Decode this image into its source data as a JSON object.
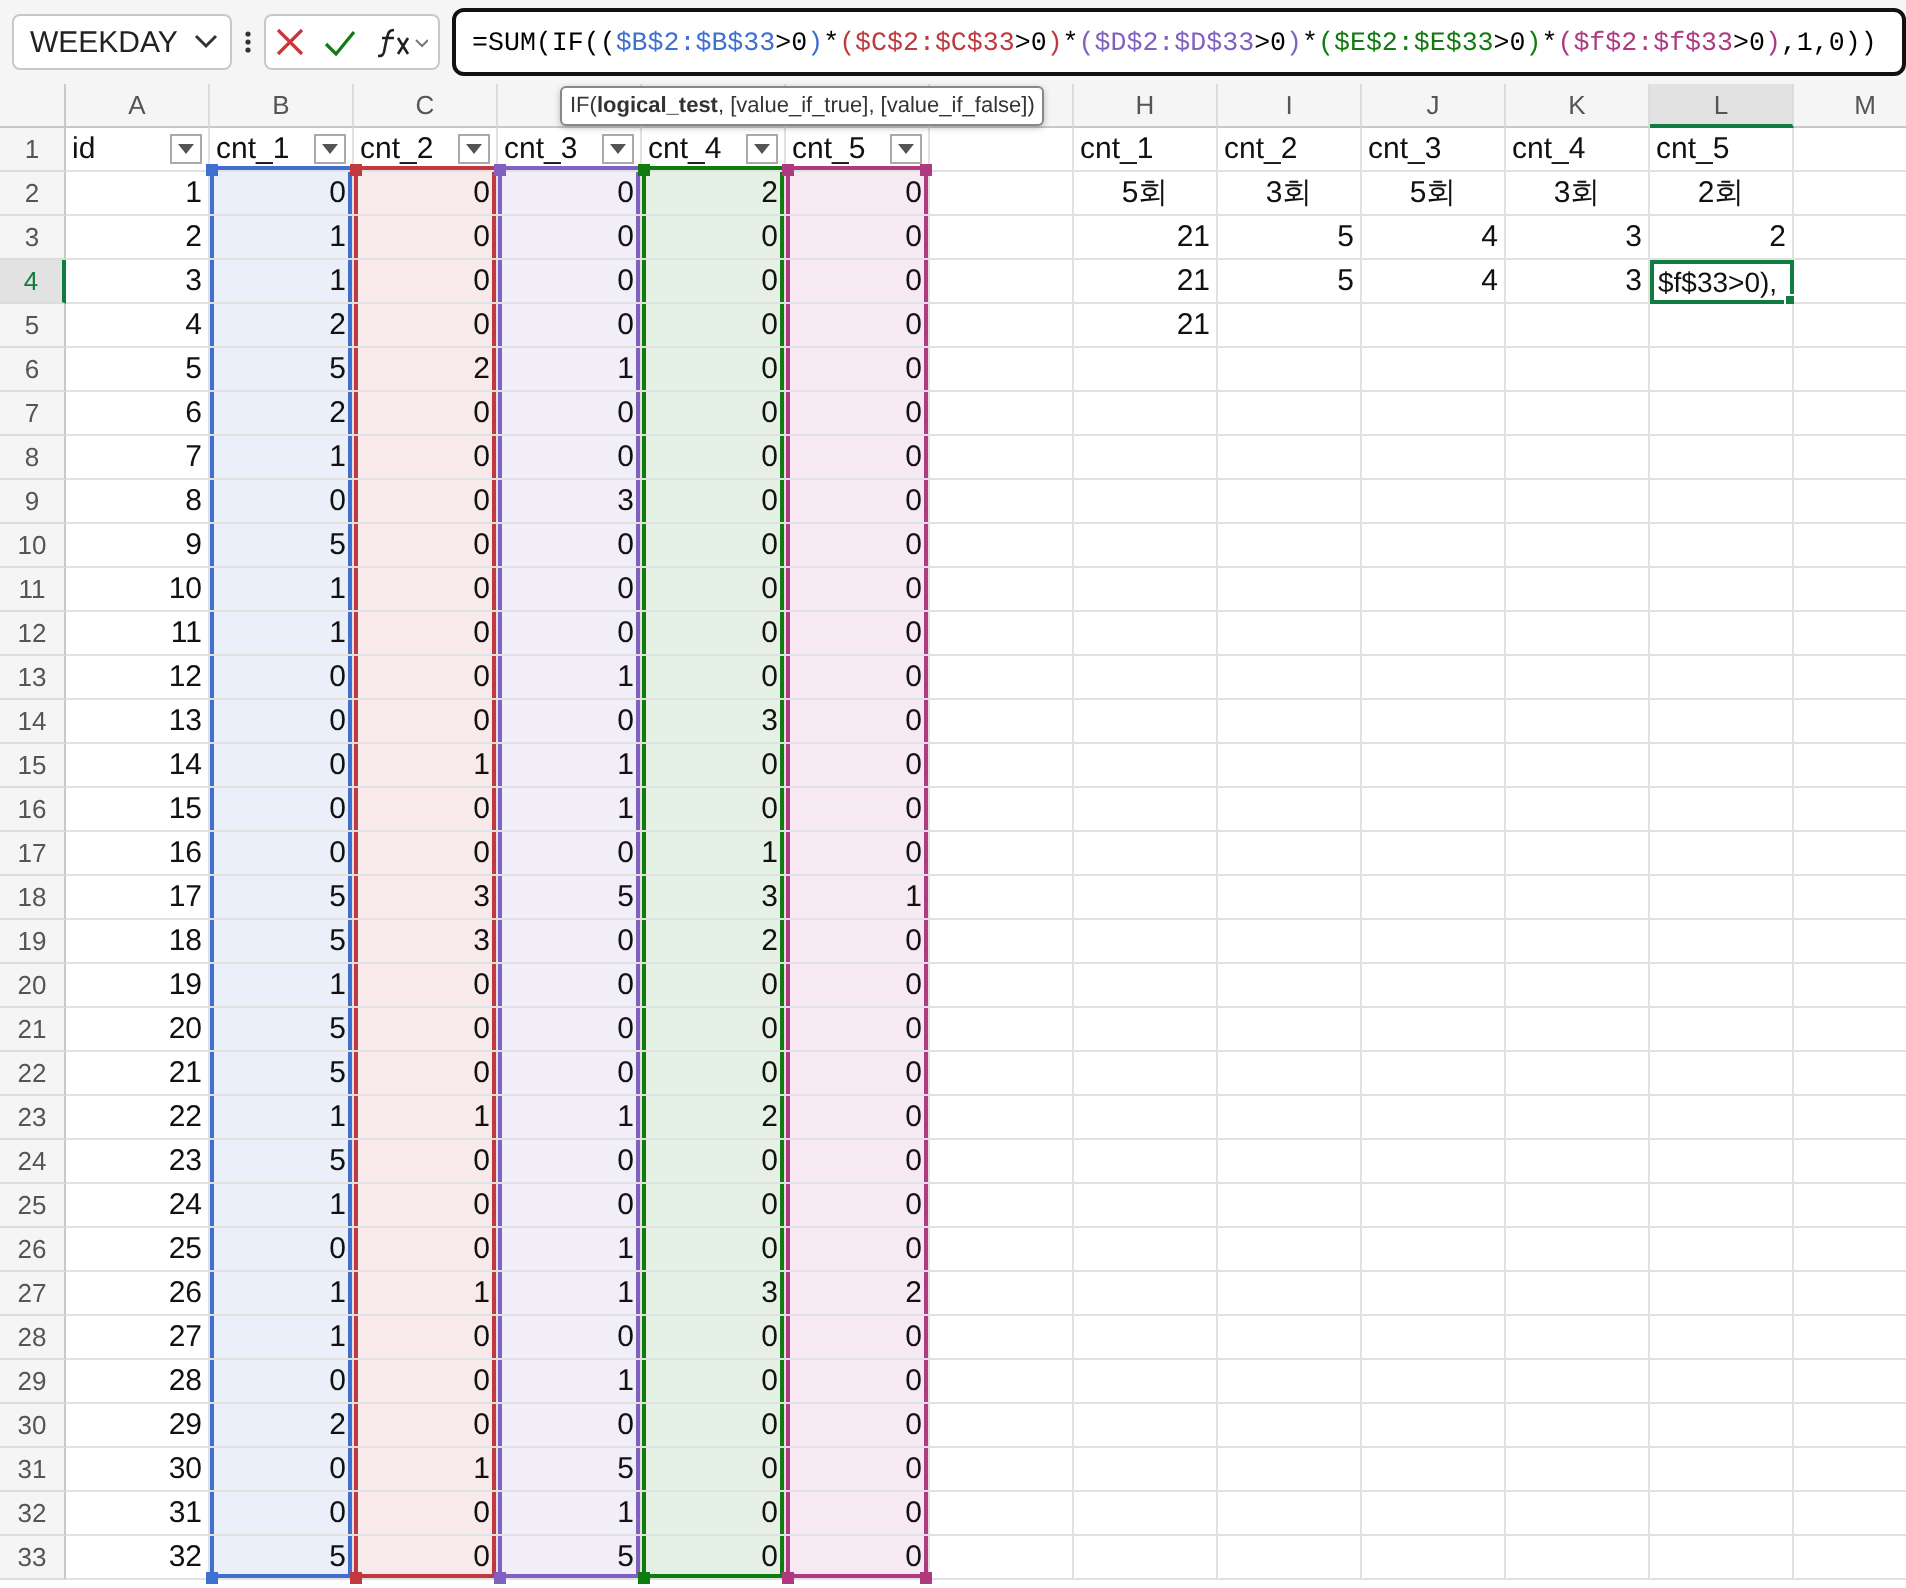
{
  "name_box": {
    "value": "WEEKDAY"
  },
  "formula_bar": {
    "segments": [
      {
        "text": "=SUM(IF(",
        "color": "#000000"
      },
      {
        "text": "(",
        "color": "#000000"
      },
      {
        "text": "$B$2:$B$33",
        "color": "#3f6fd0"
      },
      {
        "text": ">0",
        "color": "#000000"
      },
      {
        "text": ")",
        "color": "#3f6fd0"
      },
      {
        "text": "*",
        "color": "#000000"
      },
      {
        "text": "(",
        "color": "#c0393e"
      },
      {
        "text": "$C$2:$C$33",
        "color": "#c0393e"
      },
      {
        "text": ">0",
        "color": "#000000"
      },
      {
        "text": ")",
        "color": "#c0393e"
      },
      {
        "text": "*",
        "color": "#000000"
      },
      {
        "text": "(",
        "color": "#8060c0"
      },
      {
        "text": "$D$2:$D$33",
        "color": "#8060c0"
      },
      {
        "text": ">0",
        "color": "#000000"
      },
      {
        "text": ")",
        "color": "#8060c0"
      },
      {
        "text": "*",
        "color": "#000000"
      },
      {
        "text": "(",
        "color": "#107c10"
      },
      {
        "text": "$E$2:$E$33",
        "color": "#107c10"
      },
      {
        "text": ">0",
        "color": "#000000"
      },
      {
        "text": ")",
        "color": "#107c10"
      },
      {
        "text": "*",
        "color": "#000000"
      },
      {
        "text": "(",
        "color": "#b03a80"
      },
      {
        "text": "$f$2:$f$33",
        "color": "#b03a80"
      },
      {
        "text": ">0",
        "color": "#000000"
      },
      {
        "text": ")",
        "color": "#b03a80"
      },
      {
        "text": ",1,0))",
        "color": "#000000"
      }
    ]
  },
  "tooltip": "IF(**logical_test**, [value_if_true], [value_if_false])",
  "column_headers": [
    {
      "label": "A",
      "selected": false
    },
    {
      "label": "B",
      "selected": false
    },
    {
      "label": "C",
      "selected": false
    },
    {
      "selected": false
    },
    {
      "selected": false
    },
    {
      "selected": false
    },
    {
      "selected": false
    },
    {
      "label": "H",
      "selected": false
    },
    {
      "label": "I",
      "selected": false
    },
    {
      "label": "J",
      "selected": false
    },
    {
      "label": "K",
      "selected": false
    },
    {
      "label": "L",
      "selected": true
    },
    {
      "label": "M",
      "selected": false
    }
  ],
  "row_headers": [
    {
      "label": "1",
      "selected": false
    },
    {
      "label": "2",
      "selected": false
    },
    {
      "label": "3",
      "selected": false
    },
    {
      "label": "4",
      "selected": true
    },
    {
      "label": "5",
      "selected": false
    },
    {
      "label": "6",
      "selected": false
    },
    {
      "label": "7",
      "selected": false
    },
    {
      "label": "8",
      "selected": false
    },
    {
      "label": "9",
      "selected": false
    },
    {
      "label": "10",
      "selected": false
    },
    {
      "label": "11",
      "selected": false
    },
    {
      "label": "12",
      "selected": false
    },
    {
      "label": "13",
      "selected": false
    },
    {
      "label": "14",
      "selected": false
    },
    {
      "label": "15",
      "selected": false
    },
    {
      "label": "16",
      "selected": false
    },
    {
      "label": "17",
      "selected": false
    },
    {
      "label": "18",
      "selected": false
    },
    {
      "label": "19",
      "selected": false
    },
    {
      "label": "20",
      "selected": false
    },
    {
      "label": "21",
      "selected": false
    },
    {
      "label": "22",
      "selected": false
    },
    {
      "label": "23",
      "selected": false
    },
    {
      "label": "24",
      "selected": false
    },
    {
      "label": "25",
      "selected": false
    },
    {
      "label": "26",
      "selected": false
    },
    {
      "label": "27",
      "selected": false
    },
    {
      "label": "28",
      "selected": false
    },
    {
      "label": "29",
      "selected": false
    },
    {
      "label": "30",
      "selected": false
    },
    {
      "label": "31",
      "selected": false
    },
    {
      "label": "32",
      "selected": false
    },
    {
      "label": "33",
      "selected": false
    }
  ],
  "table": {
    "columns": [
      {
        "label": "id"
      },
      {
        "label": "cnt_1",
        "color": "#3f6fd0"
      },
      {
        "label": "cnt_2",
        "color": "#c0393e"
      },
      {
        "label": "cnt_3",
        "color": "#8060c0"
      },
      {
        "label": "cnt_4",
        "color": "#107c10"
      },
      {
        "label": "cnt_5",
        "color": "#b03a80"
      }
    ],
    "rows": [
      [
        "1",
        "0",
        "0",
        "0",
        "2",
        "0"
      ],
      [
        "2",
        "1",
        "0",
        "0",
        "0",
        "0"
      ],
      [
        "3",
        "1",
        "0",
        "0",
        "0",
        "0"
      ],
      [
        "4",
        "2",
        "0",
        "0",
        "0",
        "0"
      ],
      [
        "5",
        "5",
        "2",
        "1",
        "0",
        "0"
      ],
      [
        "6",
        "2",
        "0",
        "0",
        "0",
        "0"
      ],
      [
        "7",
        "1",
        "0",
        "0",
        "0",
        "0"
      ],
      [
        "8",
        "0",
        "0",
        "3",
        "0",
        "0"
      ],
      [
        "9",
        "5",
        "0",
        "0",
        "0",
        "0"
      ],
      [
        "10",
        "1",
        "0",
        "0",
        "0",
        "0"
      ],
      [
        "11",
        "1",
        "0",
        "0",
        "0",
        "0"
      ],
      [
        "12",
        "0",
        "0",
        "1",
        "0",
        "0"
      ],
      [
        "13",
        "0",
        "0",
        "0",
        "3",
        "0"
      ],
      [
        "14",
        "0",
        "1",
        "1",
        "0",
        "0"
      ],
      [
        "15",
        "0",
        "0",
        "1",
        "0",
        "0"
      ],
      [
        "16",
        "0",
        "0",
        "0",
        "1",
        "0"
      ],
      [
        "17",
        "5",
        "3",
        "5",
        "3",
        "1"
      ],
      [
        "18",
        "5",
        "3",
        "0",
        "2",
        "0"
      ],
      [
        "19",
        "1",
        "0",
        "0",
        "0",
        "0"
      ],
      [
        "20",
        "5",
        "0",
        "0",
        "0",
        "0"
      ],
      [
        "21",
        "5",
        "0",
        "0",
        "0",
        "0"
      ],
      [
        "22",
        "1",
        "1",
        "1",
        "2",
        "0"
      ],
      [
        "23",
        "5",
        "0",
        "0",
        "0",
        "0"
      ],
      [
        "24",
        "1",
        "0",
        "0",
        "0",
        "0"
      ],
      [
        "25",
        "0",
        "0",
        "1",
        "0",
        "0"
      ],
      [
        "26",
        "1",
        "1",
        "1",
        "3",
        "2"
      ],
      [
        "27",
        "1",
        "0",
        "0",
        "0",
        "0"
      ],
      [
        "28",
        "0",
        "0",
        "1",
        "0",
        "0"
      ],
      [
        "29",
        "2",
        "0",
        "0",
        "0",
        "0"
      ],
      [
        "30",
        "0",
        "1",
        "5",
        "0",
        "0"
      ],
      [
        "31",
        "0",
        "0",
        "1",
        "0",
        "0"
      ],
      [
        "32",
        "5",
        "0",
        "5",
        "0",
        "0"
      ]
    ]
  },
  "summary": {
    "labels": [
      "cnt_1",
      "cnt_2",
      "cnt_3",
      "cnt_4",
      "cnt_5"
    ],
    "counts": [
      "5회",
      "3회",
      "5회",
      "3회",
      "2회"
    ],
    "rows": [
      [
        {
          "kind": "value",
          "text": "21"
        },
        {
          "kind": "value",
          "text": "5"
        },
        {
          "kind": "value",
          "text": "4"
        },
        {
          "kind": "value",
          "text": "3"
        },
        {
          "kind": "value",
          "text": "2"
        }
      ],
      [
        {
          "kind": "value",
          "text": "21"
        },
        {
          "kind": "value",
          "text": "5"
        },
        {
          "kind": "value",
          "text": "4"
        },
        {
          "kind": "value",
          "text": "3"
        },
        {
          "kind": "editing",
          "text": "$f$33>0),"
        }
      ],
      [
        {
          "kind": "value",
          "text": "21"
        }
      ]
    ]
  }
}
